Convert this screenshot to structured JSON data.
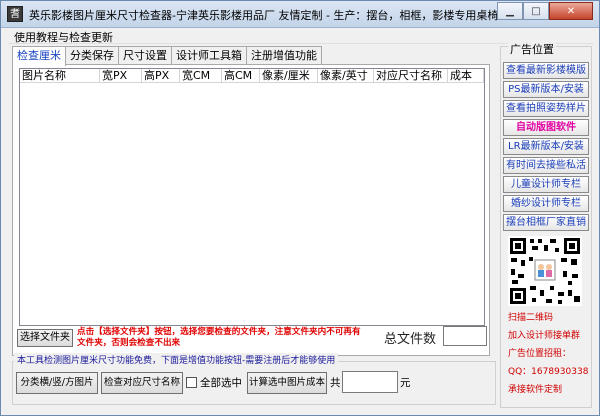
{
  "window": {
    "title": "英乐影楼图片厘米尺寸检查器-宁津英乐影楼用品厂 友情定制 - 生产：摆台，相框，影楼专用桌椅",
    "app_icon": "耆"
  },
  "menu": {
    "item": "使用教程与检查更新"
  },
  "tabs": [
    "检查厘米",
    "分类保存",
    "尺寸设置",
    "设计师工具箱",
    "注册增值功能"
  ],
  "table": {
    "columns": [
      "图片名称",
      "宽PX",
      "高PX",
      "宽CM",
      "高CM",
      "像素/厘米",
      "像素/英寸",
      "对应尺寸名称",
      "成本"
    ]
  },
  "actions": {
    "select_folder": "选择文件夹",
    "hint": "点击【选择文件夹】按钮，选择您要检查的文件夹，注意文件夹内不可再有文件夹，否则会检查不出来",
    "total_label": "总文件数",
    "group_title": "本工具检测图片厘米尺寸功能免费，下面是增值功能按钮-需要注册后才能够使用",
    "btn_classify": "分类横/竖/方图片",
    "btn_check_size": "检查对应尺寸名称",
    "check_all": "全部选中",
    "btn_calc": "计算选中图片成本",
    "gong": "共",
    "yuan": "元"
  },
  "ads": {
    "title": "广告位置",
    "items": [
      {
        "label": "查看最新影楼模版",
        "color": "#1a3db8"
      },
      {
        "label": "PS最新版本/安装",
        "color": "#1a3db8"
      },
      {
        "label": "查看拍照姿势样片",
        "color": "#1a3db8"
      },
      {
        "label": "自动版图软件",
        "color": "#e000a0"
      },
      {
        "label": "LR最新版本/安装",
        "color": "#1a3db8"
      },
      {
        "label": "有时间去接些私活",
        "color": "#1a3db8"
      },
      {
        "label": "儿童设计师专栏",
        "color": "#1a3db8"
      },
      {
        "label": "婚纱设计师专栏",
        "color": "#1a3db8"
      },
      {
        "label": "摆台相框厂家直销",
        "color": "#1a3db8"
      }
    ],
    "info": [
      "扫描二维码",
      "加入设计师接单群",
      "广告位置招租：",
      "QQ：1678930338",
      "承接软件定制"
    ]
  }
}
